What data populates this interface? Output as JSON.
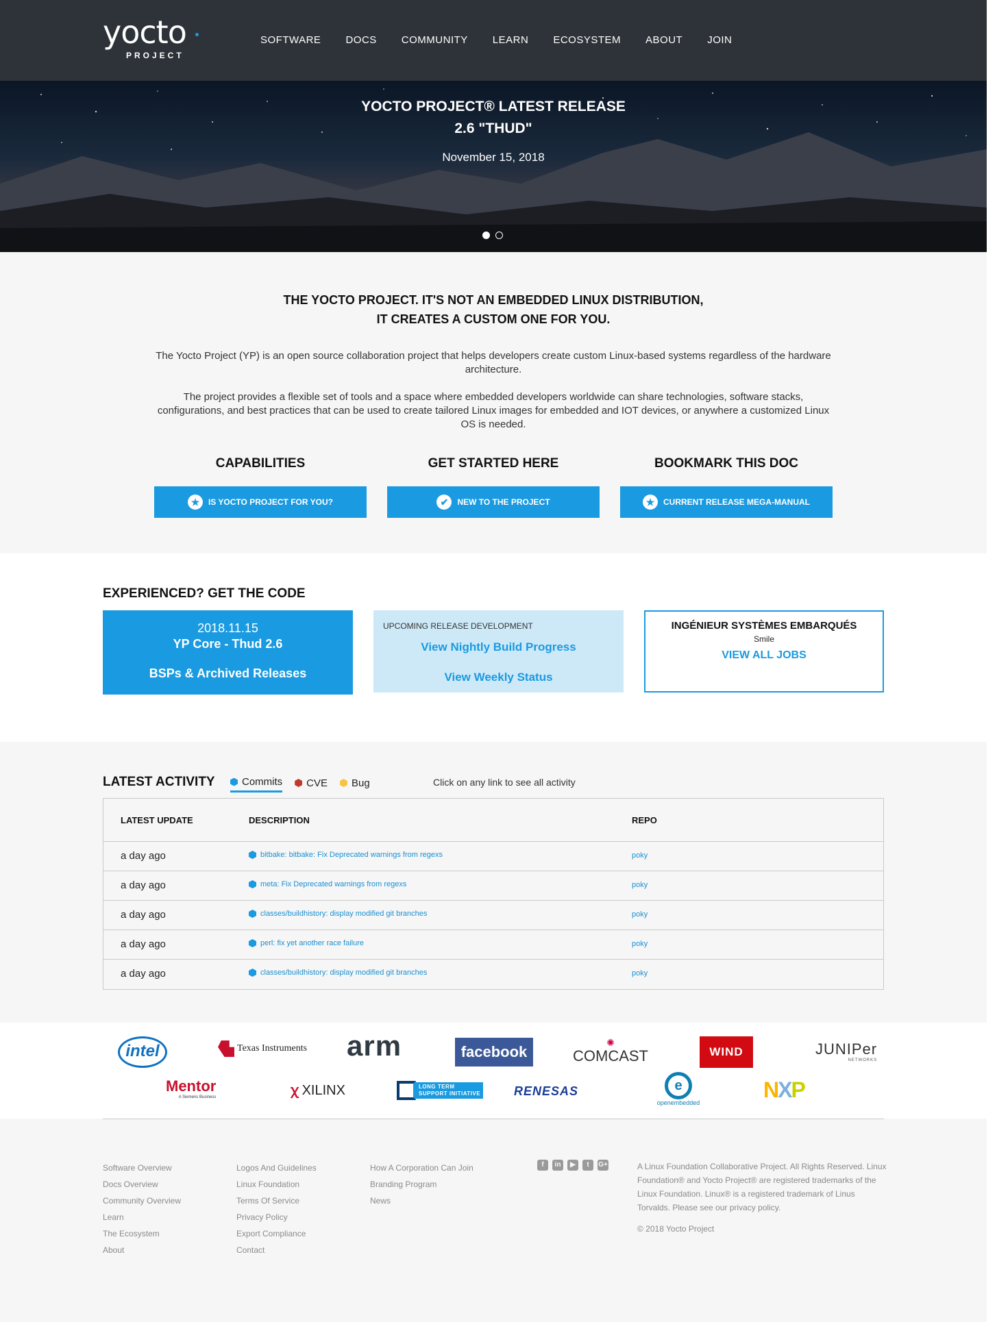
{
  "header": {
    "logo": "yocto",
    "logo_sub": "PROJECT",
    "nav": [
      "SOFTWARE",
      "DOCS",
      "COMMUNITY",
      "LEARN",
      "ECOSYSTEM",
      "ABOUT",
      "JOIN"
    ]
  },
  "hero": {
    "title_line1": "YOCTO PROJECT® LATEST RELEASE",
    "title_line2": "2.6 \"THUD\"",
    "date": "November 15, 2018",
    "slides": 2,
    "active_slide": 1
  },
  "intro": {
    "heading_line1": "THE YOCTO PROJECT.  IT'S NOT AN EMBEDDED LINUX DISTRIBUTION,",
    "heading_line2": "IT CREATES A CUSTOM ONE FOR YOU.",
    "paragraph1": "The Yocto Project (YP) is an open source collaboration project that helps developers create custom Linux-based systems regardless of the hardware architecture.",
    "paragraph2": "The project provides a flexible set of tools and a space where embedded developers worldwide can share technologies, software stacks, configurations, and best practices that can be used to create tailored Linux images for embedded and IOT devices, or anywhere a customized Linux OS is needed.",
    "ctas": [
      {
        "title": "CAPABILITIES",
        "button": "IS YOCTO PROJECT FOR YOU?",
        "icon": "star-badge-icon"
      },
      {
        "title": "GET STARTED HERE",
        "button": "NEW TO THE PROJECT",
        "icon": "check-badge-icon"
      },
      {
        "title": "BOOKMARK THIS DOC",
        "button": "CURRENT RELEASE MEGA-MANUAL",
        "icon": "star-badge-icon"
      }
    ]
  },
  "code": {
    "heading": "EXPERIENCED? GET THE CODE",
    "release_date": "2018.11.15",
    "release_name": "YP Core - Thud 2.6",
    "bsp_link": "BSPs & Archived Releases",
    "upcoming_label": "UPCOMING RELEASE DEVELOPMENT",
    "nightly_link": "View Nightly Build Progress",
    "weekly_link": "View Weekly Status",
    "job_title": "INGÉNIEUR SYSTÈMES EMBARQUÉS",
    "job_company": "Smile",
    "jobs_link": "VIEW ALL JOBS"
  },
  "activity": {
    "heading": "LATEST ACTIVITY",
    "tabs": [
      {
        "label": "Commits",
        "color": "#1a9ae0"
      },
      {
        "label": "CVE",
        "color": "#c0392b"
      },
      {
        "label": "Bug",
        "color": "#f5c542"
      }
    ],
    "active_tab": "Commits",
    "hint": "Click on any link to see all activity",
    "columns": [
      "LATEST UPDATE",
      "DESCRIPTION",
      "REPO"
    ],
    "rows": [
      {
        "time": "a day ago",
        "description": "bitbake: bitbake: Fix Deprecated warnings from regexs",
        "repo": "poky"
      },
      {
        "time": "a day ago",
        "description": "meta: Fix Deprecated warnings from regexs",
        "repo": "poky"
      },
      {
        "time": "a day ago",
        "description": "classes/buildhistory: display modified git branches",
        "repo": "poky"
      },
      {
        "time": "a day ago",
        "description": "perl: fix yet another race failure",
        "repo": "poky"
      },
      {
        "time": "a day ago",
        "description": "classes/buildhistory: display modified git branches",
        "repo": "poky"
      }
    ]
  },
  "sponsors": {
    "intel": "intel",
    "ti": "Texas Instruments",
    "arm": "arm",
    "facebook": "facebook",
    "comcast": "COMCAST",
    "wind": "WIND",
    "juniper": "JUNIPer",
    "juniper_sub": "NETWORKS",
    "mentor": "Mentor",
    "mentor_sub": "A Siemens Business",
    "xilinx": "XILINX",
    "lts_line1": "LONG TERM",
    "lts_line2": "SUPPORT INITIATIVE",
    "renesas": "RENESAS",
    "openembedded": "openembedded",
    "nxp_n": "N",
    "nxp_x": "X",
    "nxp_p": "P"
  },
  "footer": {
    "col1": [
      "Software Overview",
      "Docs Overview",
      "Community Overview",
      "Learn",
      "The Ecosystem",
      "About"
    ],
    "col2": [
      "Logos And Guidelines",
      "Linux Foundation",
      "Terms Of Service",
      "Privacy Policy",
      "Export Compliance",
      "Contact"
    ],
    "col3": [
      "How A Corporation Can Join",
      "Branding Program",
      "News"
    ],
    "social": [
      "facebook-icon",
      "linkedin-icon",
      "youtube-icon",
      "twitter-icon",
      "google-plus-icon"
    ],
    "legal": "A Linux Foundation Collaborative Project. All Rights Reserved. Linux Foundation® and Yocto Project® are registered trademarks of the Linux Foundation. Linux® is a registered trademark of Linus Torvalds. Please see our privacy policy.",
    "copyright": "© 2018 Yocto Project"
  },
  "colors": {
    "accent": "#1a9ae0",
    "header_bg": "#2d3338",
    "section_bg": "#f6f6f6"
  }
}
